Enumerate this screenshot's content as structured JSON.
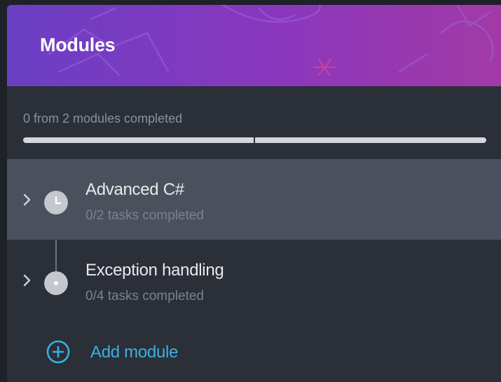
{
  "header": {
    "title": "Modules"
  },
  "progress": {
    "text": "0 from 2 modules completed",
    "completed": 0,
    "total": 2
  },
  "modules": [
    {
      "title": "Advanced C#",
      "subtitle": "0/2 tasks completed",
      "icon": "clock-icon",
      "expanded": false
    },
    {
      "title": "Exception handling",
      "subtitle": "0/4 tasks completed",
      "icon": "dot-icon",
      "expanded": false
    }
  ],
  "add_module": {
    "label": "Add module",
    "icon": "plus-circle-icon"
  },
  "colors": {
    "header_gradient_start": "#6a3fc4",
    "header_gradient_end": "#a23aa6",
    "panel_bg": "#2b2f38",
    "active_row_bg": "#4b515c",
    "accent": "#3ab0e2"
  }
}
